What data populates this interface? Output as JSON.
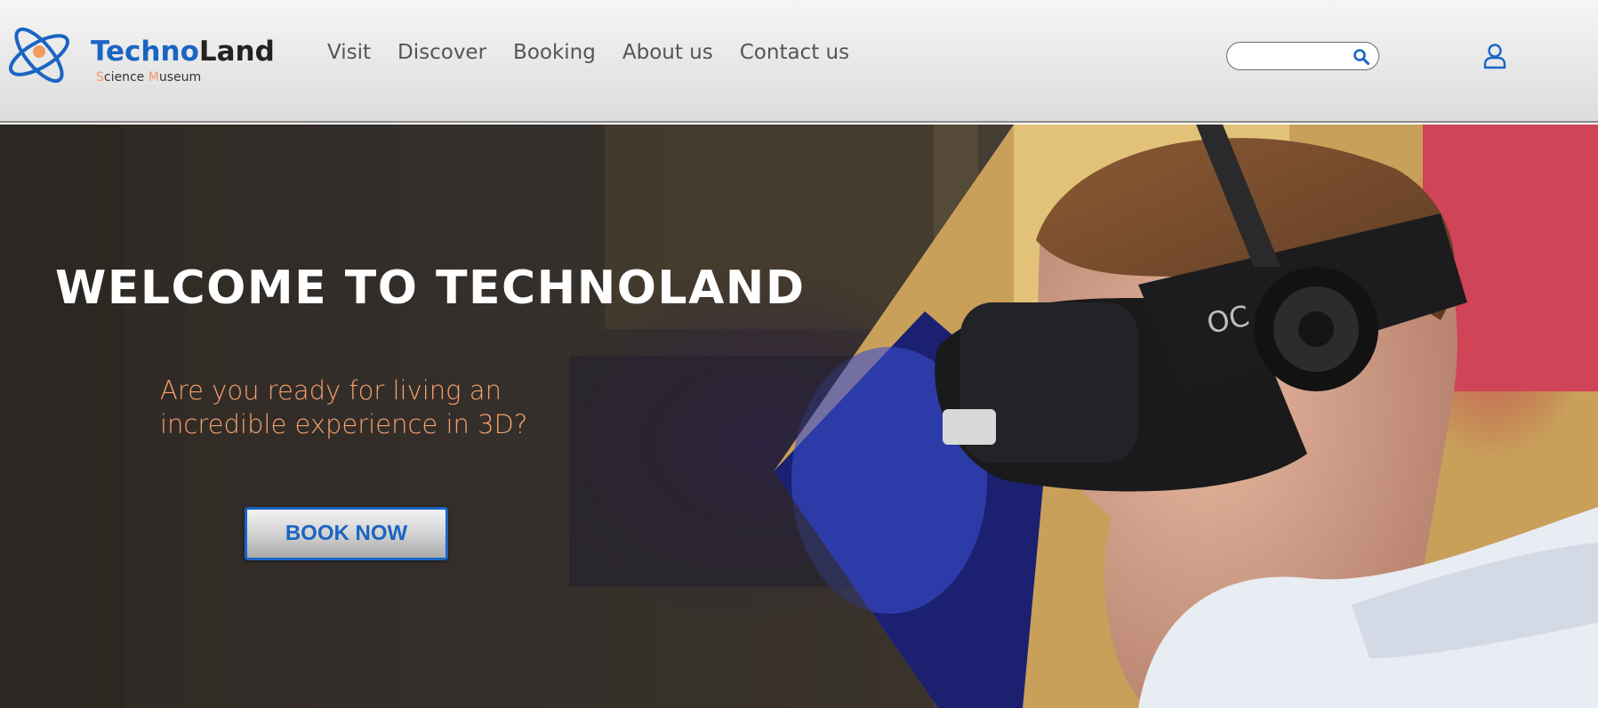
{
  "brand": {
    "name_part1": "Techno",
    "name_part2": "Land",
    "tagline_s": "S",
    "tagline_rest1": "cience ",
    "tagline_m": "M",
    "tagline_rest2": "useum",
    "accent_color": "#1a64c4",
    "orange_color": "#f39a62"
  },
  "nav": {
    "items": [
      {
        "label": "Visit"
      },
      {
        "label": "Discover"
      },
      {
        "label": "Booking"
      },
      {
        "label": "About us"
      },
      {
        "label": "Contact us"
      }
    ]
  },
  "search": {
    "value": "",
    "placeholder": "",
    "icon": "search-icon"
  },
  "account": {
    "icon": "user-icon"
  },
  "hero": {
    "title": "WELCOME TO TECHNOLAND",
    "subtitle_line1": "Are you ready for living an",
    "subtitle_line2": "incredible experience in 3D?",
    "cta_label": "BOOK NOW",
    "subtitle_color": "#f5a06c"
  }
}
